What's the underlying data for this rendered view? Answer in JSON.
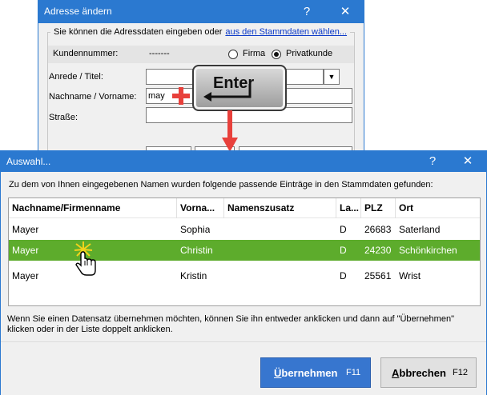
{
  "back_window": {
    "title": "Adresse ändern",
    "help_label": "?",
    "close_label": "✕",
    "group_label": "Sie können die Adressdaten eingeben oder",
    "group_link": "aus den Stammdaten wählen...",
    "customer_number_label": "Kundennummer:",
    "customer_number_value": "-------",
    "radio_firma": "Firma",
    "radio_privat": "Privatkunde",
    "salutation_label": "Anrede / Titel:",
    "name_label": "Nachname / Vorname:",
    "name_value": "may",
    "street_label": "Straße:"
  },
  "overlay": {
    "enter_key_label": "Enter"
  },
  "dialog": {
    "title": "Auswahl...",
    "help_label": "?",
    "close_label": "✕",
    "info_text": "Zu dem von Ihnen eingegebenen Namen wurden folgende passende Einträge in den Stammdaten gefunden:",
    "columns": [
      "Nachname/Firmenname",
      "Vorna...",
      "Namenszusatz",
      "La...",
      "PLZ",
      "Ort"
    ],
    "rows": [
      {
        "name": "Mayer",
        "first": "Sophia",
        "suffix": "",
        "country": "D",
        "plz": "26683",
        "city": "Saterland"
      },
      {
        "name": "Mayer",
        "first": "Christin",
        "suffix": "",
        "country": "D",
        "plz": "24230",
        "city": "Schönkirchen"
      },
      {
        "name": "Mayer",
        "first": "Kristin",
        "suffix": "",
        "country": "D",
        "plz": "25561",
        "city": "Wrist"
      }
    ],
    "hint": "Wenn Sie einen Datensatz übernehmen möchten, können Sie ihn entweder anklicken und dann auf \"Übernehmen\" klicken oder in der Liste doppelt anklicken.",
    "ok_mnemonic": "Ü",
    "ok_rest": "bernehmen",
    "ok_key": "F11",
    "cancel_mnemonic": "A",
    "cancel_rest": "bbrechen",
    "cancel_key": "F12"
  },
  "colors": {
    "titlebar": "#2b79d0",
    "selected_row": "#5dac2c",
    "primary_button": "#3776cf",
    "arrow": "#e8403b"
  }
}
